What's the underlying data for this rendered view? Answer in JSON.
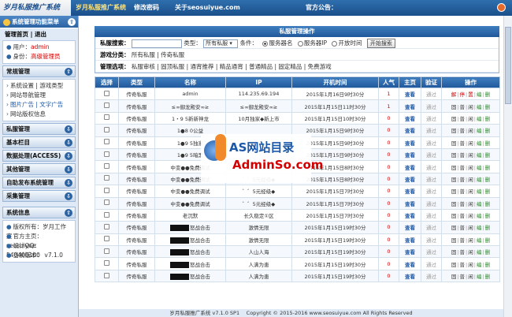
{
  "header": {
    "logo": "岁月私服推广系统",
    "nav": [
      "岁月私服推广系统",
      "修改密码",
      "关于seosuiyue.com"
    ],
    "notice_label": "官方公告："
  },
  "sidebar": {
    "menu_title": "系统管理功能菜单",
    "top_links": "管理首页 | 退出",
    "user_label": "用户：",
    "user_value": "admin",
    "identity_label": "身份：",
    "identity_value": "高级管理员",
    "sections": {
      "routine": "常规管理",
      "routine_items": [
        "系统设置 | 游戏类型",
        "网站导航管理",
        "图片广告 | 文字广告",
        "网站版权信息"
      ],
      "pserver": "私服管理",
      "basic": "基本栏目",
      "data": "数据处理(ACCESS)",
      "other": "其他管理",
      "auto": "自助发布系统管理",
      "collect": "采集管理",
      "sysinfo": "系统信息",
      "sysinfo_items": [
        "版权所有：岁月工作室",
        "官方主页：seosuiyue",
        "设计QQ：540400100",
        "当前版本： v7.1.0"
      ]
    }
  },
  "main": {
    "panel_title": "私服管理操作",
    "search_label": "私服搜索：",
    "search_value": "",
    "type_label": "类型：",
    "type_value": "所有私服",
    "condition_label": "条件：",
    "conditions": [
      "服务器名",
      "服务器IP",
      "开放时间"
    ],
    "search_button": "开始搜索",
    "category_label": "游戏分类：",
    "category_values": "所有私服 | 传奇私服",
    "manage_label": "管理选项：",
    "manage_values": "私服审核 | 固顶私服 | 通宵推荐 | 精品通宵 | 普通精品 | 固定精品 | 免费游戏"
  },
  "table": {
    "columns": [
      "选择",
      "类型",
      "名称",
      "IP",
      "开机时间",
      "人气",
      "主页",
      "验证",
      "操作"
    ],
    "rows": [
      {
        "type": "传奇私服",
        "name": "admin",
        "ip": "114.235.69.194",
        "time": "2015年1月16日9时30分",
        "pop": "1",
        "home": "查看",
        "verify": "通过",
        "ops": "解|停|置|编|删",
        "redacted": false
      },
      {
        "type": "传奇私服",
        "name": "≤∞御龙殿安∞≥",
        "ip": "≤∞御龙殿安∞≥",
        "time": "2015年1月15日11时30分",
        "pop": "1",
        "home": "查看",
        "verify": "通过",
        "ops": "固|普|闲|编|删",
        "redacted": false
      },
      {
        "type": "传奇私服",
        "name": "1・9 5新新神龙",
        "ip": "10月独家◆新上市",
        "time": "2015年1月15日10时30分",
        "pop": "0",
        "home": "查看",
        "verify": "通过",
        "ops": "固|普|闲|编|删",
        "redacted": false
      },
      {
        "type": "传奇私服",
        "name": "1●8 0公益",
        "ip": "",
        "time": "2015年1月15日9时30分",
        "pop": "0",
        "home": "查看",
        "verify": "通过",
        "ops": "固|普|闲|编|删",
        "redacted": false
      },
      {
        "type": "传奇私服",
        "name": "1●9 5独家",
        "ip": "",
        "time": "2015年1月15日9时30分",
        "pop": "0",
        "home": "查看",
        "verify": "通过",
        "ops": "固|普|闲|编|删",
        "redacted": false
      },
      {
        "type": "传奇私服",
        "name": "1●9 5暗黑",
        "ip": "",
        "time": "2015年1月15日9时30分",
        "pop": "0",
        "home": "查看",
        "verify": "通过",
        "ops": "固|普|闲|编|删",
        "redacted": false
      },
      {
        "type": "传奇私服",
        "name": "中变●●免费调试",
        "ip": "",
        "time": "2015年1月15日8时30分",
        "pop": "0",
        "home": "查看",
        "verify": "通过",
        "ops": "固|普|闲|编|删",
        "redacted": false
      },
      {
        "type": "传奇私服",
        "name": "中变●●免费调试",
        "ip": "゛゛5元经级◆",
        "time": "2015年1月15日8时30分",
        "pop": "0",
        "home": "查看",
        "verify": "通过",
        "ops": "固|普|闲|编|删",
        "redacted": false
      },
      {
        "type": "传奇私服",
        "name": "中变●●免费调试",
        "ip": "゛゛5元经级◆",
        "time": "2015年1月15日7时30分",
        "pop": "0",
        "home": "查看",
        "verify": "通过",
        "ops": "固|普|闲|编|删",
        "redacted": false
      },
      {
        "type": "传奇私服",
        "name": "中变●●免费调试",
        "ip": "゛゛5元经级◆",
        "time": "2015年1月15日7时30分",
        "pop": "0",
        "home": "查看",
        "verify": "通过",
        "ops": "固|普|闲|编|删",
        "redacted": false
      },
      {
        "type": "传奇私服",
        "name": "老沉默",
        "ip": "长久稳定①区",
        "time": "2015年1月15日7时30分",
        "pop": "0",
        "home": "查看",
        "verify": "通过",
        "ops": "固|普|闲|编|删",
        "redacted": false
      },
      {
        "type": "传奇私服",
        "name": "怒战合击",
        "ip": "激情无限",
        "time": "2015年1月15日19时30分",
        "pop": "0",
        "home": "查看",
        "verify": "通过",
        "ops": "固|普|闲|编|删",
        "redacted": true
      },
      {
        "type": "传奇私服",
        "name": "怒战合击",
        "ip": "激情无限",
        "time": "2015年1月15日19时30分",
        "pop": "0",
        "home": "查看",
        "verify": "通过",
        "ops": "固|普|闲|编|删",
        "redacted": true
      },
      {
        "type": "传奇私服",
        "name": "怒战合击",
        "ip": "人山人海",
        "time": "2015年1月15日19时30分",
        "pop": "0",
        "home": "查看",
        "verify": "通过",
        "ops": "固|普|闲|编|删",
        "redacted": true
      },
      {
        "type": "传奇私服",
        "name": "怒战合击",
        "ip": "人满为患",
        "time": "2015年1月15日19时30分",
        "pop": "0",
        "home": "查看",
        "verify": "通过",
        "ops": "固|普|闲|编|删",
        "redacted": true
      },
      {
        "type": "传奇私服",
        "name": "怒战合击",
        "ip": "人满为患",
        "time": "2015年1月15日19时30分",
        "pop": "0",
        "home": "查看",
        "verify": "通过",
        "ops": "固|普|闲|编|删",
        "redacted": true
      }
    ]
  },
  "watermark": {
    "line1": "AS网站目录",
    "line2": "AdminSo.com"
  },
  "footer": {
    "text": "岁月私服推广系统 v7.1.0 SP1 　Copyright © 2015-2016 www.seosuiyue.com All Rights Reserved"
  },
  "colors": {
    "header_blue": "#1a4f8a",
    "accent_red": "#d40000",
    "link_blue": "#1c58a8",
    "sidebar_bg": "#dfeaf6"
  }
}
